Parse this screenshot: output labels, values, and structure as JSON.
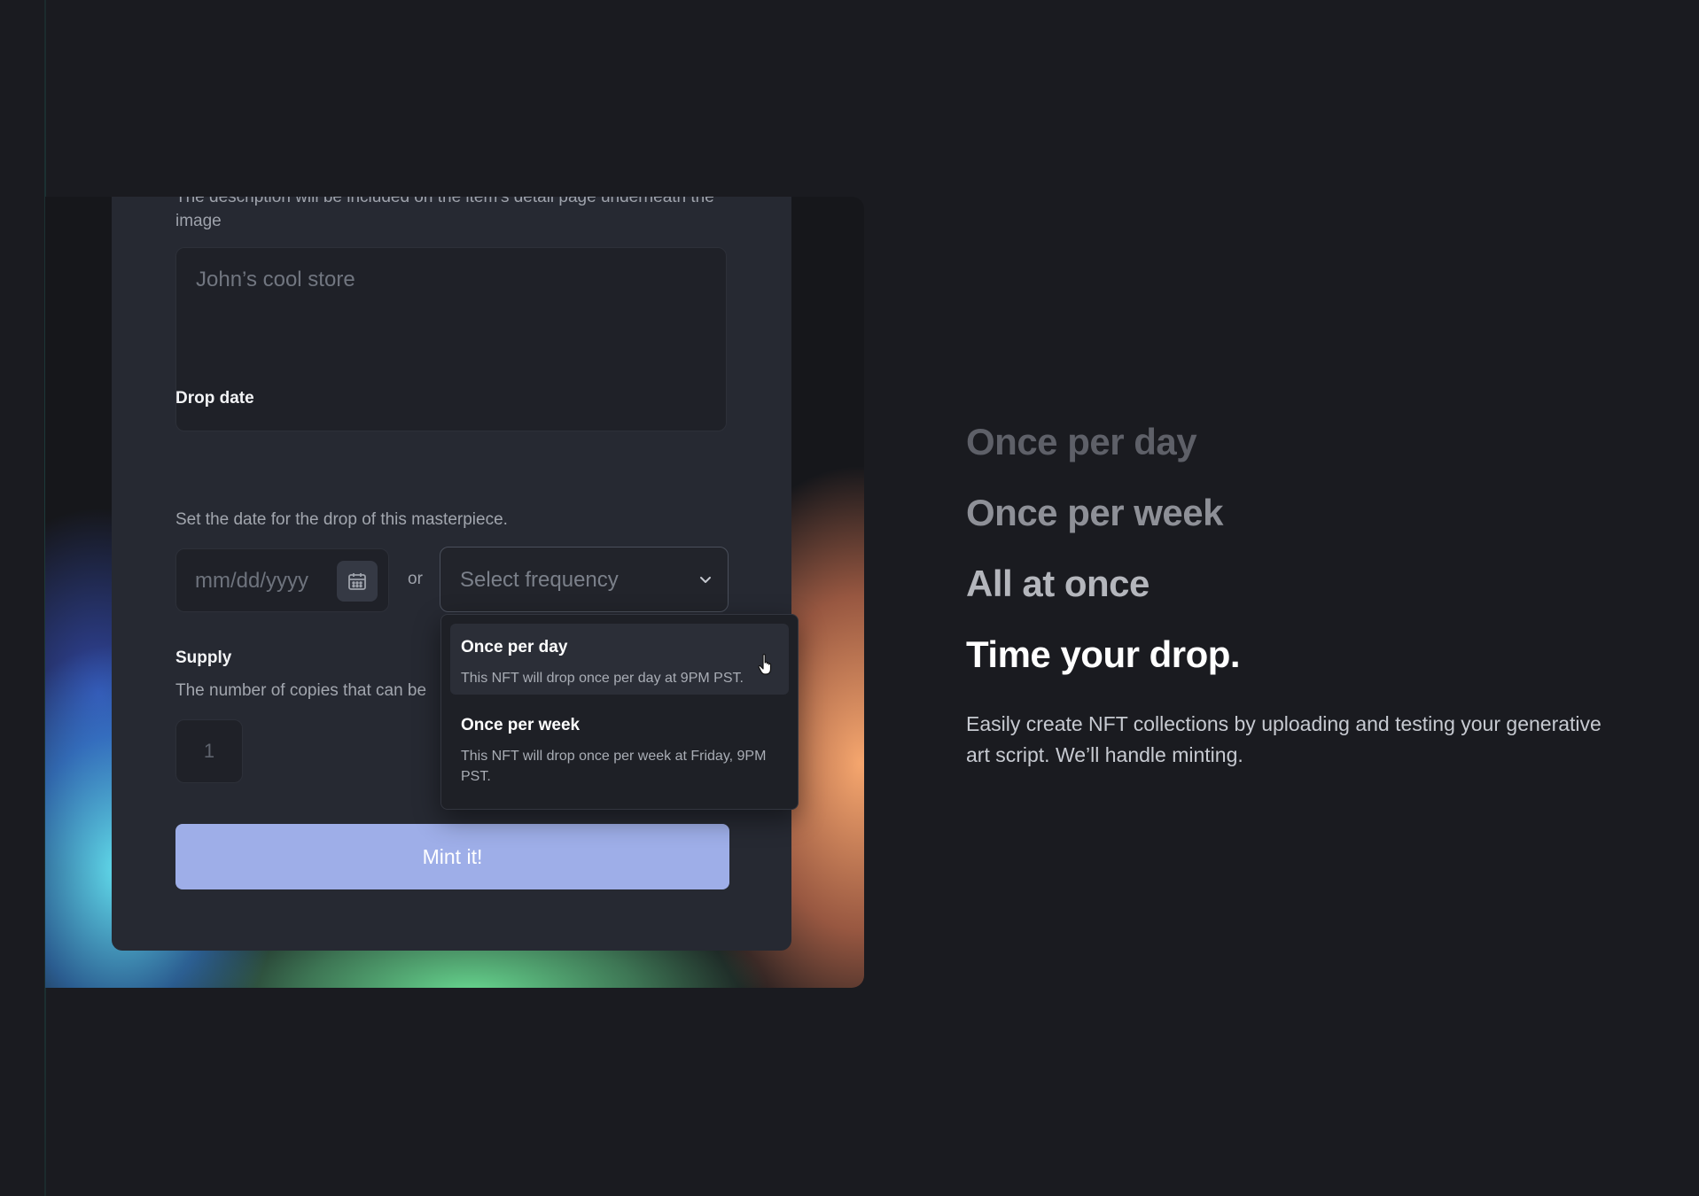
{
  "form": {
    "description_help_cut": "The description will be included on the item's detail page underneath the image",
    "description_placeholder": "John’s cool store",
    "drop_date": {
      "label": "Drop date",
      "help": "Set the date for the drop of this masterpiece.",
      "date_placeholder": "mm/dd/yyyy",
      "or_text": "or",
      "frequency_placeholder": "Select frequency"
    },
    "supply": {
      "label": "Supply",
      "help": "The number of copies that can be",
      "value": "1"
    },
    "submit_label": "Mint it!"
  },
  "dropdown": {
    "options": [
      {
        "title": "Once per day",
        "description": "This NFT will drop once per day at 9PM PST."
      },
      {
        "title": "Once per week",
        "description": "This NFT will drop once per week at Friday, 9PM PST."
      }
    ]
  },
  "feature": {
    "options": [
      "Once per day",
      "Once per week",
      "All at once"
    ],
    "heading": "Time your drop.",
    "body": "Easily create NFT collections by uploading and testing your generative art script. We’ll handle minting."
  },
  "colors": {
    "background": "#1a1b20",
    "card": "#262932",
    "button": "#9eaee8",
    "glow_cyan": "#66e8f8",
    "glow_green": "#6ce296",
    "glow_orange": "#f5a66e"
  },
  "icons": [
    "calendar-icon",
    "chevron-down-icon",
    "pointer-cursor-icon"
  ]
}
